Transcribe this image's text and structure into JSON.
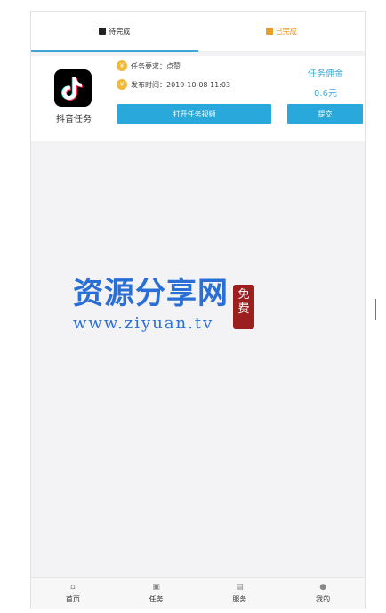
{
  "tabs": [
    {
      "label": "待完成",
      "icon": "list-icon",
      "active": true
    },
    {
      "label": "已完成",
      "icon": "check-icon",
      "active": false
    }
  ],
  "task": {
    "app_name": "抖音任务",
    "requirement_label": "任务要求：",
    "requirement_value": "点赞",
    "published_label": "发布时间：",
    "published_value": "2019-10-08 11:03",
    "reward_label": "任务佣金",
    "reward_value": "0.6元",
    "open_button": "打开任务视频",
    "submit_button": "提交"
  },
  "watermark": {
    "site_name": "资源分享网",
    "url": "www.ziyuan.tv",
    "stamp": "免费"
  },
  "bottom_nav": [
    {
      "label": "首页",
      "icon": "home-icon"
    },
    {
      "label": "任务",
      "icon": "task-icon"
    },
    {
      "label": "服务",
      "icon": "service-icon"
    },
    {
      "label": "我的",
      "icon": "user-icon"
    }
  ],
  "colors": {
    "accent": "#29a8dc",
    "reward": "#3ea6d8",
    "coin": "#f0b93a",
    "done_tab": "#e08a1a"
  }
}
